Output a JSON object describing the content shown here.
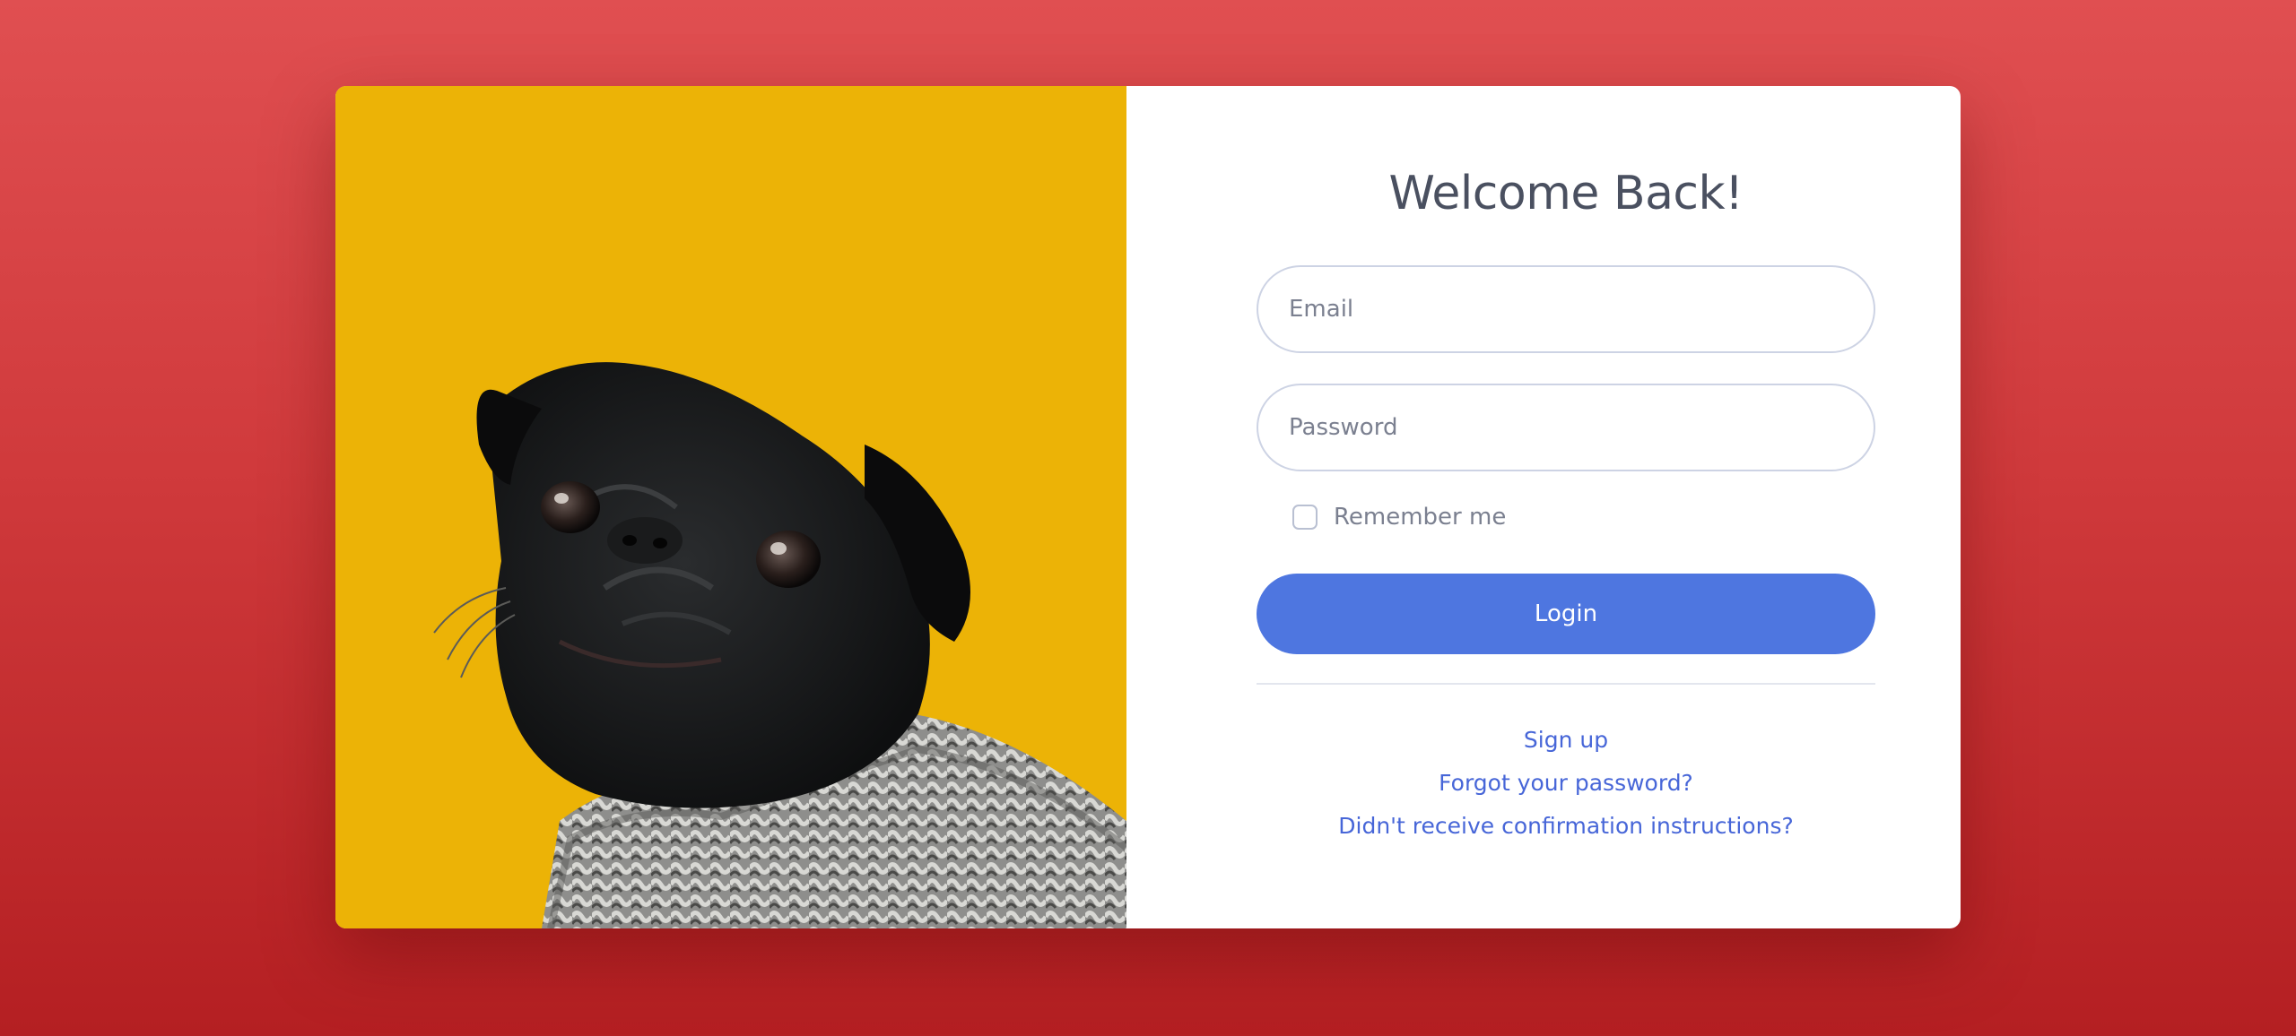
{
  "colors": {
    "background_top": "#e04f51",
    "background_bottom": "#b41f22",
    "photo_background": "#ecb306",
    "primary_button": "#4e76e0",
    "link": "#4766d8",
    "title_text": "#4a5060"
  },
  "photo": {
    "icon": "pug-in-sweater-photo"
  },
  "form": {
    "title": "Welcome Back!",
    "email_placeholder": "Email",
    "email_value": "",
    "password_placeholder": "Password",
    "password_value": "",
    "remember_label": "Remember me",
    "remember_checked": false,
    "login_label": "Login"
  },
  "links": {
    "sign_up": "Sign up",
    "forgot_password": "Forgot your password?",
    "confirmation": "Didn't receive confirmation instructions?"
  }
}
